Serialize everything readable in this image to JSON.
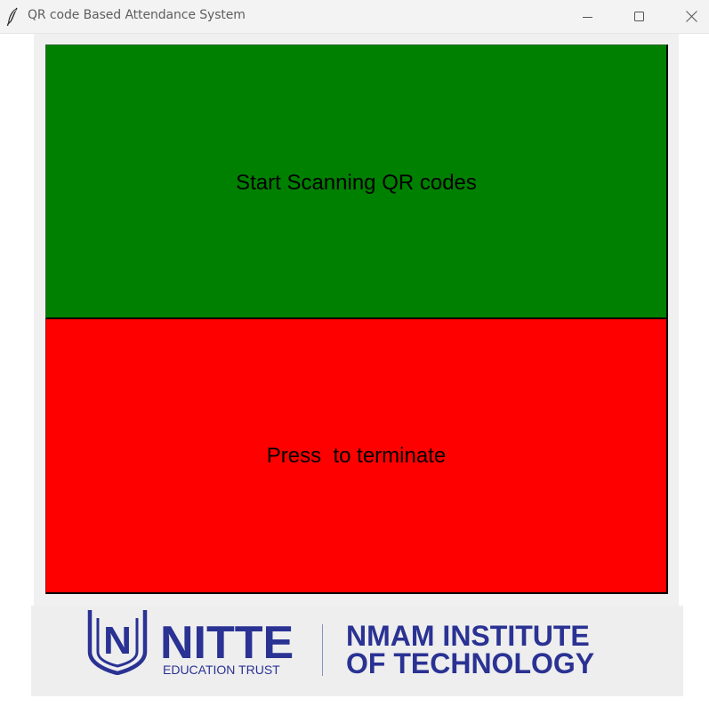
{
  "window": {
    "title": "QR code Based Attendance System"
  },
  "buttons": {
    "start_label": "Start Scanning QR codes",
    "terminate_label": "Press  to terminate"
  },
  "logo": {
    "emblem_letter": "N",
    "brand": "NITTE",
    "brand_sub": "EDUCATION TRUST",
    "institute_line1": "NMAM INSTITUTE",
    "institute_line2": "OF TECHNOLOGY"
  },
  "colors": {
    "start_button": "#008000",
    "terminate_button": "#ff0000",
    "brand": "#2a3293"
  },
  "icons": {
    "app": "feather-icon",
    "minimize": "minimize-icon",
    "maximize": "maximize-icon",
    "close": "close-icon"
  }
}
